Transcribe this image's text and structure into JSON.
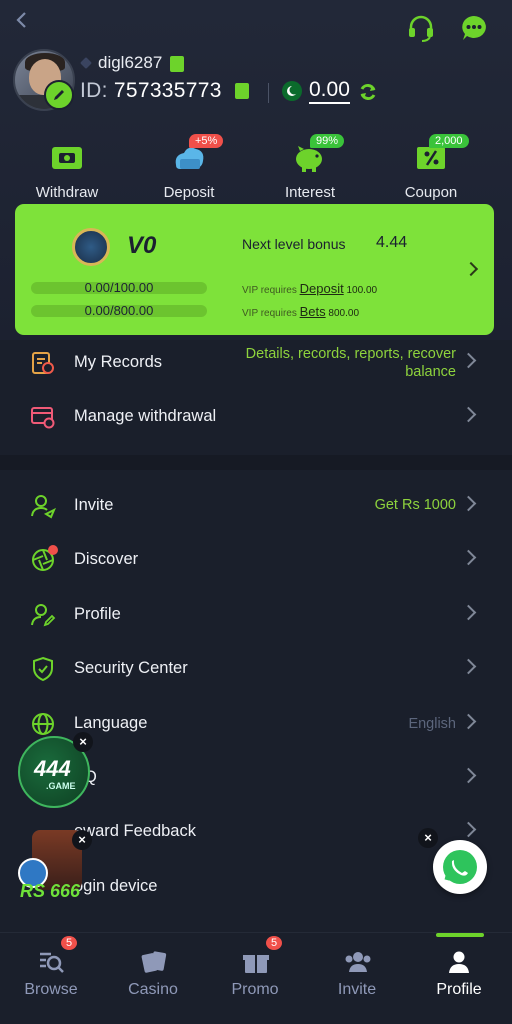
{
  "header": {
    "username": "digl6287",
    "id_label": "ID:",
    "id_value": "757335773",
    "balance": "0.00"
  },
  "shortcuts": [
    {
      "label": "Withdraw",
      "icon": "withdraw-icon",
      "badge": ""
    },
    {
      "label": "Deposit",
      "icon": "deposit-icon",
      "badge": "+5%"
    },
    {
      "label": "Interest",
      "icon": "piggy-bank-icon",
      "badge": "99%"
    },
    {
      "label": "Coupon",
      "icon": "coupon-icon",
      "badge": "2,000"
    }
  ],
  "vip": {
    "level": "V0",
    "next_label": "Next level bonus",
    "next_value": "4.44",
    "deposit_progress": "0.00/100.00",
    "bets_progress": "0.00/800.00",
    "req_prefix": "VIP requires",
    "deposit_link": "Deposit",
    "deposit_req": "100.00",
    "bets_link": "Bets",
    "bets_req": "800.00"
  },
  "menu_top": [
    {
      "label": "My Records",
      "right": "Details, records, reports, recover balance"
    },
    {
      "label": "Manage withdrawal",
      "right": ""
    }
  ],
  "menu_main": [
    {
      "label": "Invite",
      "right": "Get Rs 1000"
    },
    {
      "label": "Discover",
      "right": ""
    },
    {
      "label": "Profile",
      "right": ""
    },
    {
      "label": "Security Center",
      "right": ""
    },
    {
      "label": "Language",
      "right": "English"
    },
    {
      "label": "Q",
      "right": ""
    },
    {
      "label": "eward Feedback",
      "right": ""
    },
    {
      "label": "ogin device",
      "right": ""
    }
  ],
  "floats": {
    "game_label": "444",
    "game_sub": ".GAME",
    "promo_label": "RS 666"
  },
  "nav": [
    {
      "label": "Browse",
      "badge": "5"
    },
    {
      "label": "Casino",
      "badge": ""
    },
    {
      "label": "Promo",
      "badge": "5"
    },
    {
      "label": "Invite",
      "badge": ""
    },
    {
      "label": "Profile",
      "badge": ""
    }
  ],
  "colors": {
    "accent": "#6dd32b",
    "vip_card": "#7ee23a",
    "background": "#1a1f2b",
    "badge_red": "#f0504a"
  }
}
